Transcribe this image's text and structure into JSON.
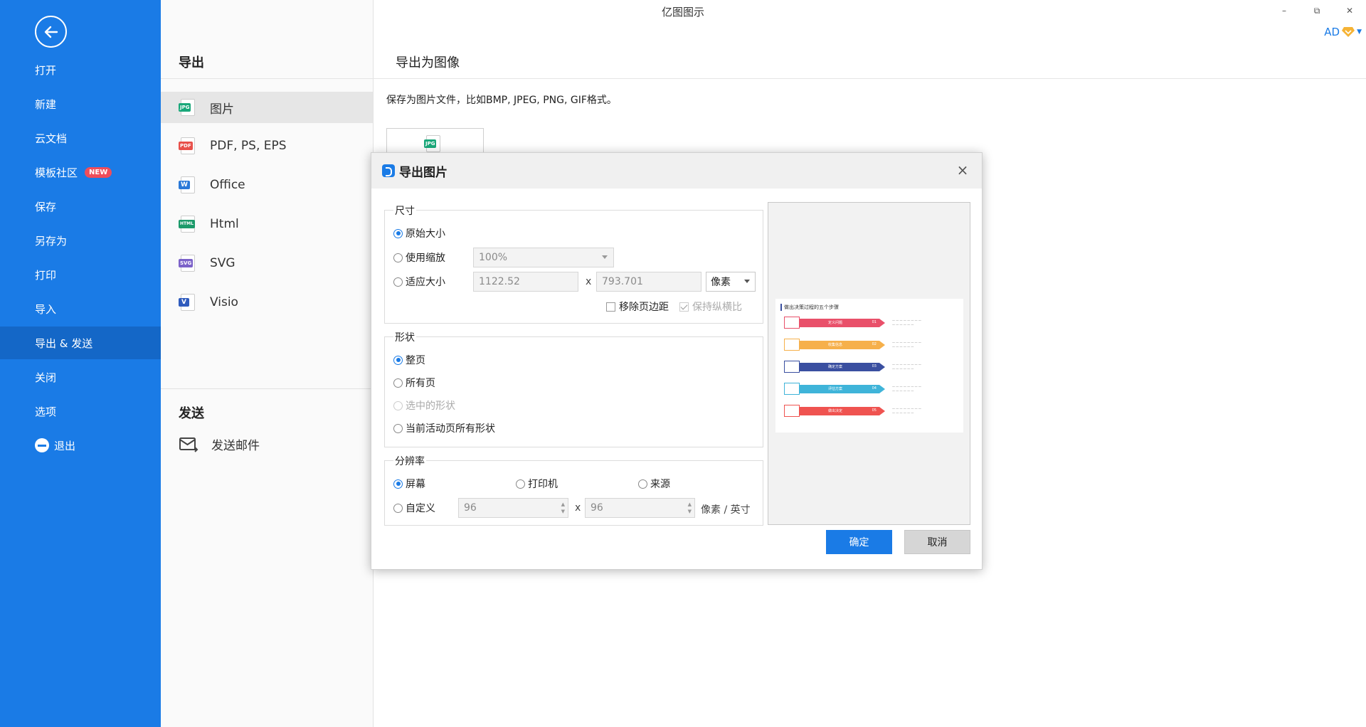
{
  "app": {
    "title": "亿图图示"
  },
  "window": {
    "minimize": "–",
    "restore": "⧉",
    "close": "✕"
  },
  "user": {
    "name": "AD"
  },
  "sidebar": {
    "items": [
      {
        "label": "打开"
      },
      {
        "label": "新建"
      },
      {
        "label": "云文档"
      },
      {
        "label": "模板社区",
        "badge": "NEW"
      },
      {
        "label": "保存"
      },
      {
        "label": "另存为"
      },
      {
        "label": "打印"
      },
      {
        "label": "导入"
      },
      {
        "label": "导出 & 发送",
        "active": true
      },
      {
        "label": "关闭"
      },
      {
        "label": "选项"
      },
      {
        "label": "退出"
      }
    ]
  },
  "export": {
    "heading": "导出",
    "formats": [
      {
        "label": "图片",
        "tag": "JPG",
        "color": "#1aa87a"
      },
      {
        "label": "PDF, PS, EPS",
        "tag": "PDF",
        "color": "#e8504a"
      },
      {
        "label": "Office",
        "tag": "W",
        "color": "#2b79d8"
      },
      {
        "label": "Html",
        "tag": "HTML",
        "color": "#1b9a6a"
      },
      {
        "label": "SVG",
        "tag": "SVG",
        "color": "#7c62c9"
      },
      {
        "label": "Visio",
        "tag": "V",
        "color": "#2f5bbd"
      }
    ]
  },
  "send": {
    "heading": "发送",
    "email_label": "发送邮件"
  },
  "content": {
    "title": "导出为图像",
    "description": "保存为图片文件，比如BMP, JPEG, PNG, GIF格式。",
    "thumb_tag": "JPG"
  },
  "dialog": {
    "title": "导出图片",
    "close": "×",
    "size": {
      "legend": "尺寸",
      "original": "原始大小",
      "use_scale": "使用缩放",
      "scale_value": "100%",
      "fit_size": "适应大小",
      "width": "1122.52",
      "times": "x",
      "height": "793.701",
      "unit": "像素",
      "remove_margin": "移除页边距",
      "keep_ratio": "保持纵横比"
    },
    "shape": {
      "legend": "形状",
      "whole_page": "整页",
      "all_pages": "所有页",
      "selected": "选中的形状",
      "current_page_all": "当前活动页所有形状"
    },
    "resolution": {
      "legend": "分辨率",
      "screen": "屏幕",
      "printer": "打印机",
      "source": "来源",
      "custom": "自定义",
      "x_dpi": "96",
      "times": "x",
      "y_dpi": "96",
      "unit": "像素 / 英寸"
    },
    "ok": "确定",
    "cancel": "取消"
  },
  "preview": {
    "title": "做出决策过程的五个步骤",
    "steps": [
      {
        "label": "定义问题",
        "num": "01",
        "color": "#e9506a"
      },
      {
        "label": "收集信息",
        "num": "02",
        "color": "#f6b04b"
      },
      {
        "label": "确定方案",
        "num": "03",
        "color": "#3a4fa0"
      },
      {
        "label": "评估方案",
        "num": "04",
        "color": "#3fb4d9"
      },
      {
        "label": "做出决定",
        "num": "05",
        "color": "#ef5350"
      }
    ]
  }
}
